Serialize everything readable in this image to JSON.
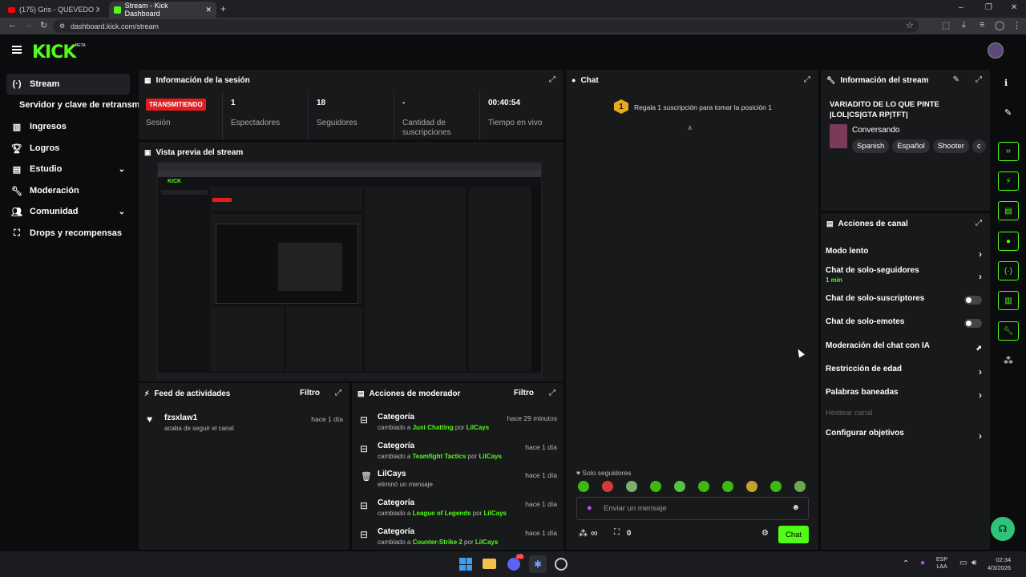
{
  "browser": {
    "tabs": [
      {
        "label": "(175) Gris - QUEVEDO X RC",
        "active": false
      },
      {
        "label": "Stream - Kick Dashboard",
        "active": true
      }
    ],
    "url": "dashboard.kick.com/stream"
  },
  "header": {
    "logo": "KICK",
    "beta": "BETA"
  },
  "sidebar": {
    "items": [
      {
        "label": "Stream",
        "icon": "broadcast-icon"
      },
      {
        "label": "Servidor y clave de retransm",
        "icon": ""
      },
      {
        "label": "Ingresos",
        "icon": "chart-icon"
      },
      {
        "label": "Logros",
        "icon": "trophy-icon"
      },
      {
        "label": "Estudio",
        "icon": "studio-icon"
      },
      {
        "label": "Moderación",
        "icon": "wrench-icon"
      },
      {
        "label": "Comunidad",
        "icon": "people-icon"
      },
      {
        "label": "Drops y recompensas",
        "icon": "gift-icon"
      }
    ]
  },
  "session": {
    "title": "Información de la sesión",
    "live_badge": "TRANSMITIENDO",
    "live_label": "Sesión",
    "viewers_value": "1",
    "viewers_label": "Espectadores",
    "followers_value": "18",
    "followers_label": "Seguidores",
    "subs_value": "-",
    "subs_label": "Cantidad de suscripciones",
    "time_value": "00:40:54",
    "time_label": "Tiempo en vivo"
  },
  "preview": {
    "title": "Vista previa del stream"
  },
  "feed": {
    "title": "Feed de actividades",
    "filter": "Filtro",
    "items": [
      {
        "title": "fzsxlaw1",
        "sub": "acaba de seguir el canal",
        "time": "hace 1 día"
      }
    ]
  },
  "modactions": {
    "title": "Acciones de moderador",
    "filter": "Filtro",
    "items": [
      {
        "title": "Categoría",
        "pre": "cambiado a ",
        "hl": "Just Chatting",
        "mid": " por ",
        "user": "LilCays",
        "time": "hace 29 minutos"
      },
      {
        "title": "Categoría",
        "pre": "cambiado a ",
        "hl": "Teamfight Tactics",
        "mid": " por ",
        "user": "LilCays",
        "time": "hace 1 día"
      },
      {
        "title": "LilCays",
        "pre": "eliminó un mensaje",
        "hl": "",
        "mid": "",
        "user": "",
        "time": "hace 1 día"
      },
      {
        "title": "Categoría",
        "pre": "cambiado a ",
        "hl": "League of Legends",
        "mid": " por ",
        "user": "LilCays",
        "time": "hace 1 día"
      },
      {
        "title": "Categoría",
        "pre": "cambiado a ",
        "hl": "Counter-Strike 2",
        "mid": " por ",
        "user": "LilCays",
        "time": "hace 1 día"
      }
    ]
  },
  "chat": {
    "title": "Chat",
    "gift_rank": "1",
    "gift_text": "Regala 1 suscripción para tomar la posición 1",
    "mode": "Solo seguidores",
    "input_placeholder": "Enviar un mensaje",
    "infinity": "∞",
    "gift_count": "0",
    "send": "Chat"
  },
  "stream_info": {
    "title": "Información del stream",
    "stream_title": "VARIADITO DE LO QUE PINTE |LOL|CS|GTA RP|TFT|",
    "category": "Conversando",
    "tags": [
      "Spanish",
      "Español",
      "Shooter",
      "c"
    ]
  },
  "channel_actions": {
    "title": "Acciones de canal",
    "items": [
      {
        "label": "Modo lento",
        "sub": "",
        "control": "arrow"
      },
      {
        "label": "Chat de solo-seguidores",
        "sub": "1 min",
        "control": "arrow"
      },
      {
        "label": "Chat de solo-suscriptores",
        "sub": "",
        "control": "toggle"
      },
      {
        "label": "Chat de solo-emotes",
        "sub": "",
        "control": "toggle"
      },
      {
        "label": "Moderación del chat con IA",
        "sub": "",
        "control": "external"
      },
      {
        "label": "Restricción de edad",
        "sub": "",
        "control": "arrow"
      },
      {
        "label": "Palabras baneadas",
        "sub": "",
        "control": "arrow"
      },
      {
        "label": "Hostear canal",
        "sub": "",
        "control": "disabled"
      },
      {
        "label": "Configurar objetivos",
        "sub": "",
        "control": "arrow"
      }
    ]
  },
  "taskbar": {
    "lang1": "ESP",
    "lang2": "LAA",
    "time": "02:34",
    "date": "4/3/2026",
    "discord_badge": "23"
  },
  "colors": {
    "accent": "#53fc18",
    "live": "#e41e1e",
    "panel": "#18191b"
  }
}
